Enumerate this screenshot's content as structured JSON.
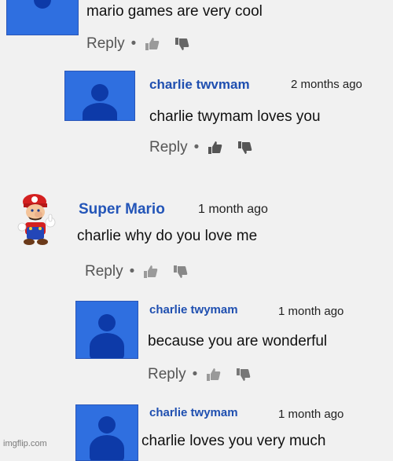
{
  "comments": [
    {
      "text": "mario games are very cool",
      "reply": "Reply",
      "dot": "•"
    },
    {
      "author": "charlie twvmam",
      "time": "2 months ago",
      "text": "charlie twymam  loves you",
      "reply": "Reply",
      "dot": "•"
    },
    {
      "author": "Super Mario",
      "time": "1 month ago",
      "text": "charlie why do you love me",
      "reply": "Reply",
      "dot": "•"
    },
    {
      "author": "charlie twymam",
      "time": "1 month ago",
      "text": "because you are wonderful",
      "reply": "Reply",
      "dot": "•"
    },
    {
      "author": "charlie twymam",
      "time": "1 month ago",
      "text": "charlie loves you very much"
    }
  ],
  "watermark": "imgflip.com",
  "colors": {
    "avatar_blue": "#2f6fe0",
    "author_blue": "#1f4fb0"
  }
}
